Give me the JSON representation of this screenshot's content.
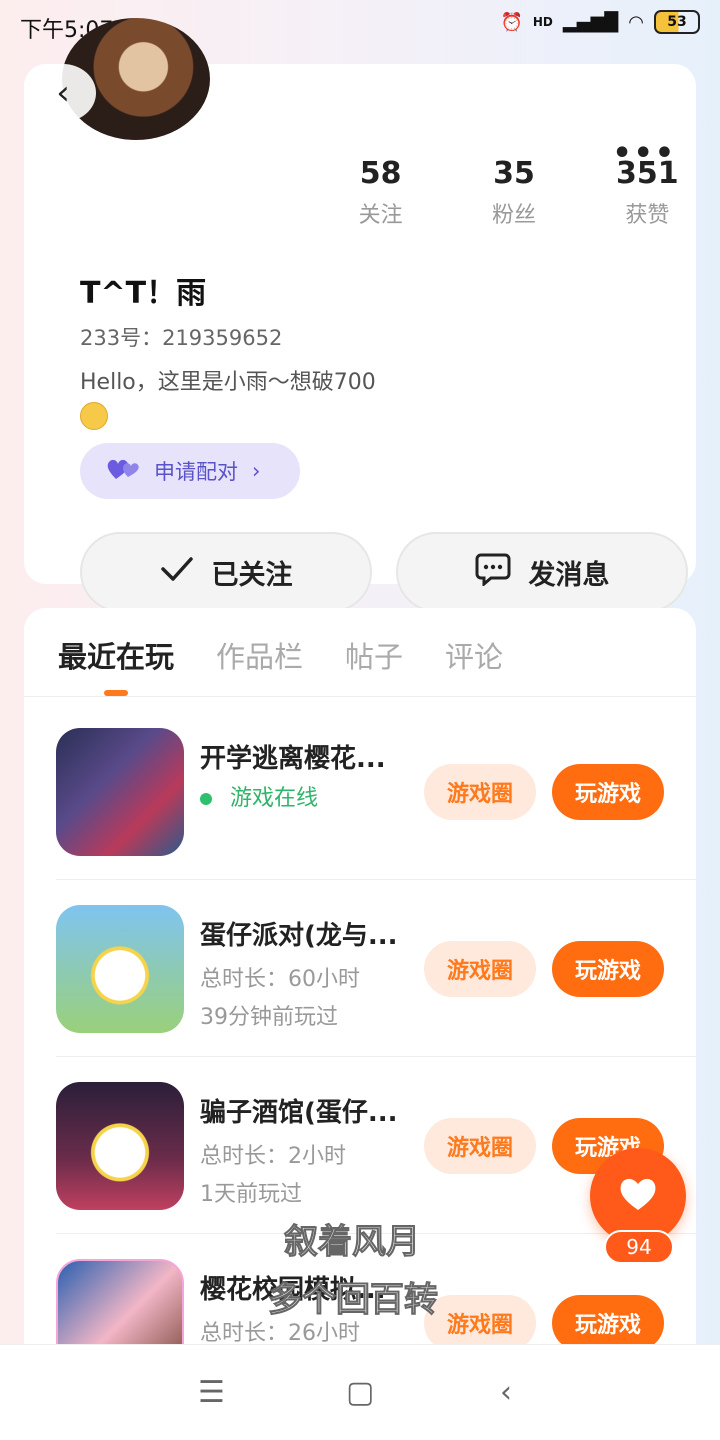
{
  "status_bar": {
    "time": "下午5:07",
    "network": "HD",
    "battery": "53"
  },
  "profile": {
    "stats": [
      {
        "num": "58",
        "label": "关注"
      },
      {
        "num": "35",
        "label": "粉丝"
      },
      {
        "num": "351",
        "label": "获赞"
      }
    ],
    "name": "T^T！雨",
    "id_text": "233号：219359652",
    "bio": "Hello，这里是小雨～想破700",
    "pair_label": "申请配对",
    "follow_label": "已关注",
    "message_label": "发消息"
  },
  "tabs": [
    "最近在玩",
    "作品栏",
    "帖子",
    "评论"
  ],
  "games": [
    {
      "title": "开学逃离樱花...",
      "status": "游戏在线",
      "circle": "游戏圈",
      "play": "玩游戏"
    },
    {
      "title": "蛋仔派对(龙与...",
      "duration": "总时长：60小时",
      "last": "39分钟前玩过",
      "circle": "游戏圈",
      "play": "玩游戏"
    },
    {
      "title": "骗子酒馆(蛋仔...",
      "duration": "总时长：2小时",
      "last": "1天前玩过",
      "circle": "游戏圈",
      "play": "玩游戏"
    },
    {
      "title": "樱花校园模拟...",
      "duration": "总时长：26小时",
      "circle": "游戏圈",
      "play": "玩游戏"
    }
  ],
  "like_count": "94",
  "lyrics": {
    "line1": "叙着风月",
    "line2": "多个回百转"
  },
  "colors": {
    "accent": "#ff6d10",
    "pair_bg": "#e7e3fb",
    "online": "#2fb56a"
  }
}
